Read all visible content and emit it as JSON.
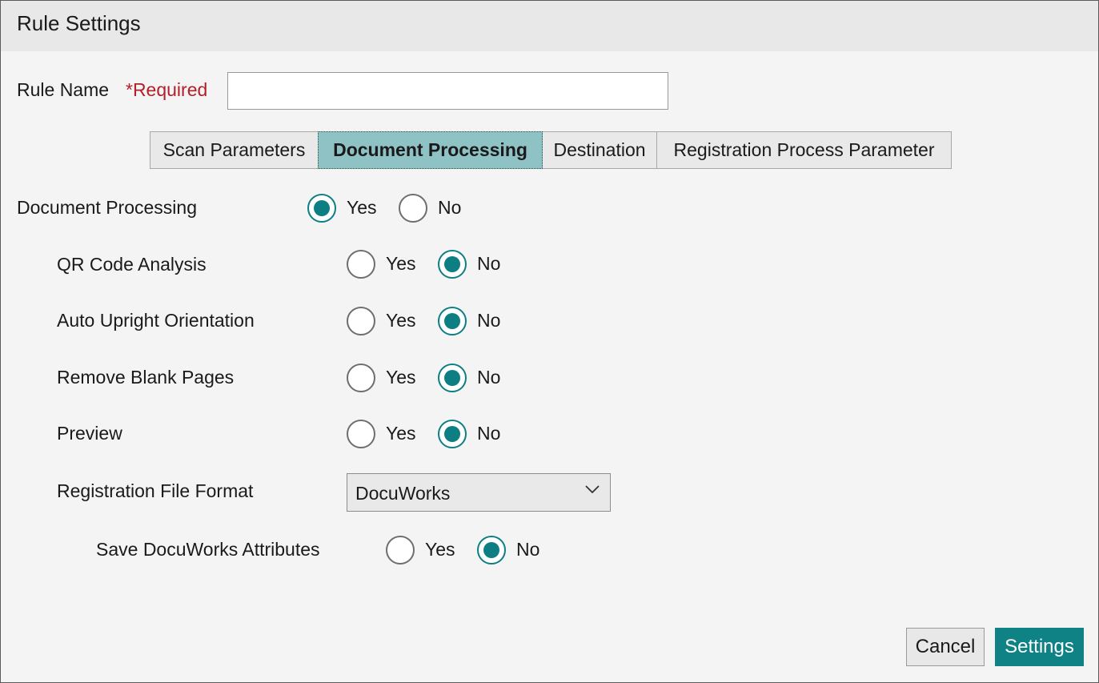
{
  "dialog": {
    "title": "Rule Settings"
  },
  "rule_name": {
    "label": "Rule Name",
    "required": "*Required",
    "value": "",
    "placeholder": ""
  },
  "tabs": [
    {
      "label": "Scan Parameters",
      "active": false
    },
    {
      "label": "Document Processing",
      "active": true
    },
    {
      "label": "Destination",
      "active": false
    },
    {
      "label": "Registration Process Parameter",
      "active": false
    }
  ],
  "options": {
    "yes": "Yes",
    "no": "No"
  },
  "settings": [
    {
      "label": "Document Processing",
      "selected": "Yes"
    },
    {
      "label": "QR Code Analysis",
      "selected": "No"
    },
    {
      "label": "Auto Upright Orientation",
      "selected": "No"
    },
    {
      "label": "Remove Blank Pages",
      "selected": "No"
    },
    {
      "label": "Preview",
      "selected": "No"
    },
    {
      "label": "Save DocuWorks Attributes",
      "selected": "No"
    }
  ],
  "file_format": {
    "label": "Registration File Format",
    "value": "DocuWorks"
  },
  "buttons": {
    "cancel": "Cancel",
    "settings": "Settings"
  },
  "colors": {
    "accent": "#0f8286",
    "active_tab": "#8ec2c5",
    "required": "#b2202a"
  },
  "icons": {
    "select_arrow": "chevron-down-icon"
  }
}
